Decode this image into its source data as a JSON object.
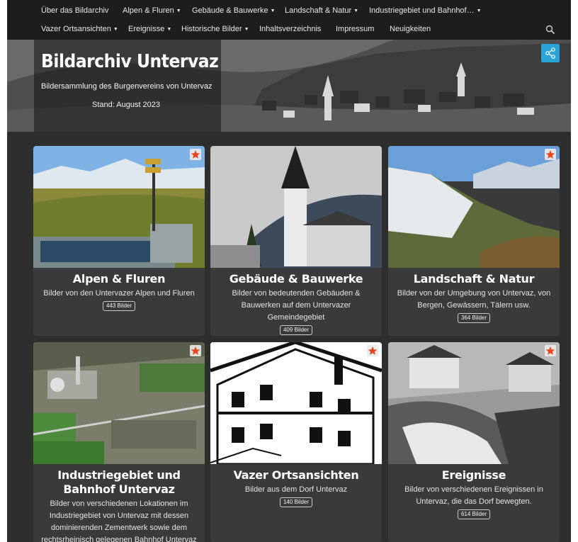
{
  "nav": {
    "row1": [
      {
        "label": "Über das Bildarchiv",
        "caret": ""
      },
      {
        "label": "Alpen & Fluren",
        "caret": "▼"
      },
      {
        "label": "Gebäude & Bauwerke",
        "caret": "▼"
      },
      {
        "label": "Landschaft & Natur",
        "caret": "▼"
      },
      {
        "label": "Industriegebiet und Bahnhof…",
        "caret": "▼"
      }
    ],
    "row2": [
      {
        "label": "Vazer Ortsansichten",
        "caret": "▼"
      },
      {
        "label": "Ereignisse",
        "caret": "▼"
      },
      {
        "label": "Historische Bilder",
        "caret": "▼"
      },
      {
        "label": "Inhaltsverzeichnis",
        "caret": ""
      },
      {
        "label": "Impressum",
        "caret": ""
      },
      {
        "label": "Neuigkeiten",
        "caret": ""
      }
    ]
  },
  "hero": {
    "title": "Bildarchiv Untervaz",
    "subtitle": "Bildersammlung des Burgenvereins von Untervaz",
    "stand": "Stand: August 2023"
  },
  "cards": [
    {
      "title": "Alpen & Fluren",
      "desc": "Bilder von den Untervazer Alpen und Fluren",
      "count": "443 Bilder"
    },
    {
      "title": "Gebäude & Bauwerke",
      "desc": "Bilder von bedeutenden Gebäuden & Bauwerken auf dem Untervazer Gemeindegebiet",
      "count": "409 Bilder"
    },
    {
      "title": "Landschaft & Natur",
      "desc": "Bilder von der Umgebung von Untervaz, von Bergen, Gewässern, Tälern usw.",
      "count": "364 Bilder"
    },
    {
      "title": "Industriegebiet und Bahnhof Untervaz",
      "desc": "Bilder von verschiedenen Lokationen im Industriegebiet von Untervaz mit dessen dominierenden Zementwerk sowie dem rechtsrheinisch gelegenen Bahnhof Untervaz",
      "count": ""
    },
    {
      "title": "Vazer Ortsansichten",
      "desc": "Bilder aus dem Dorf Untervaz",
      "count": "140 Bilder"
    },
    {
      "title": "Ereignisse",
      "desc": "Bilder von verschiedenen Ereignissen in Untervaz, die das Dorf bewegten.",
      "count": "614 Bilder"
    }
  ],
  "colors": {
    "accent": "#2aa4d6",
    "star": "#e8471c",
    "background": "#2e2e2e",
    "nav": "#1d1d1d"
  }
}
